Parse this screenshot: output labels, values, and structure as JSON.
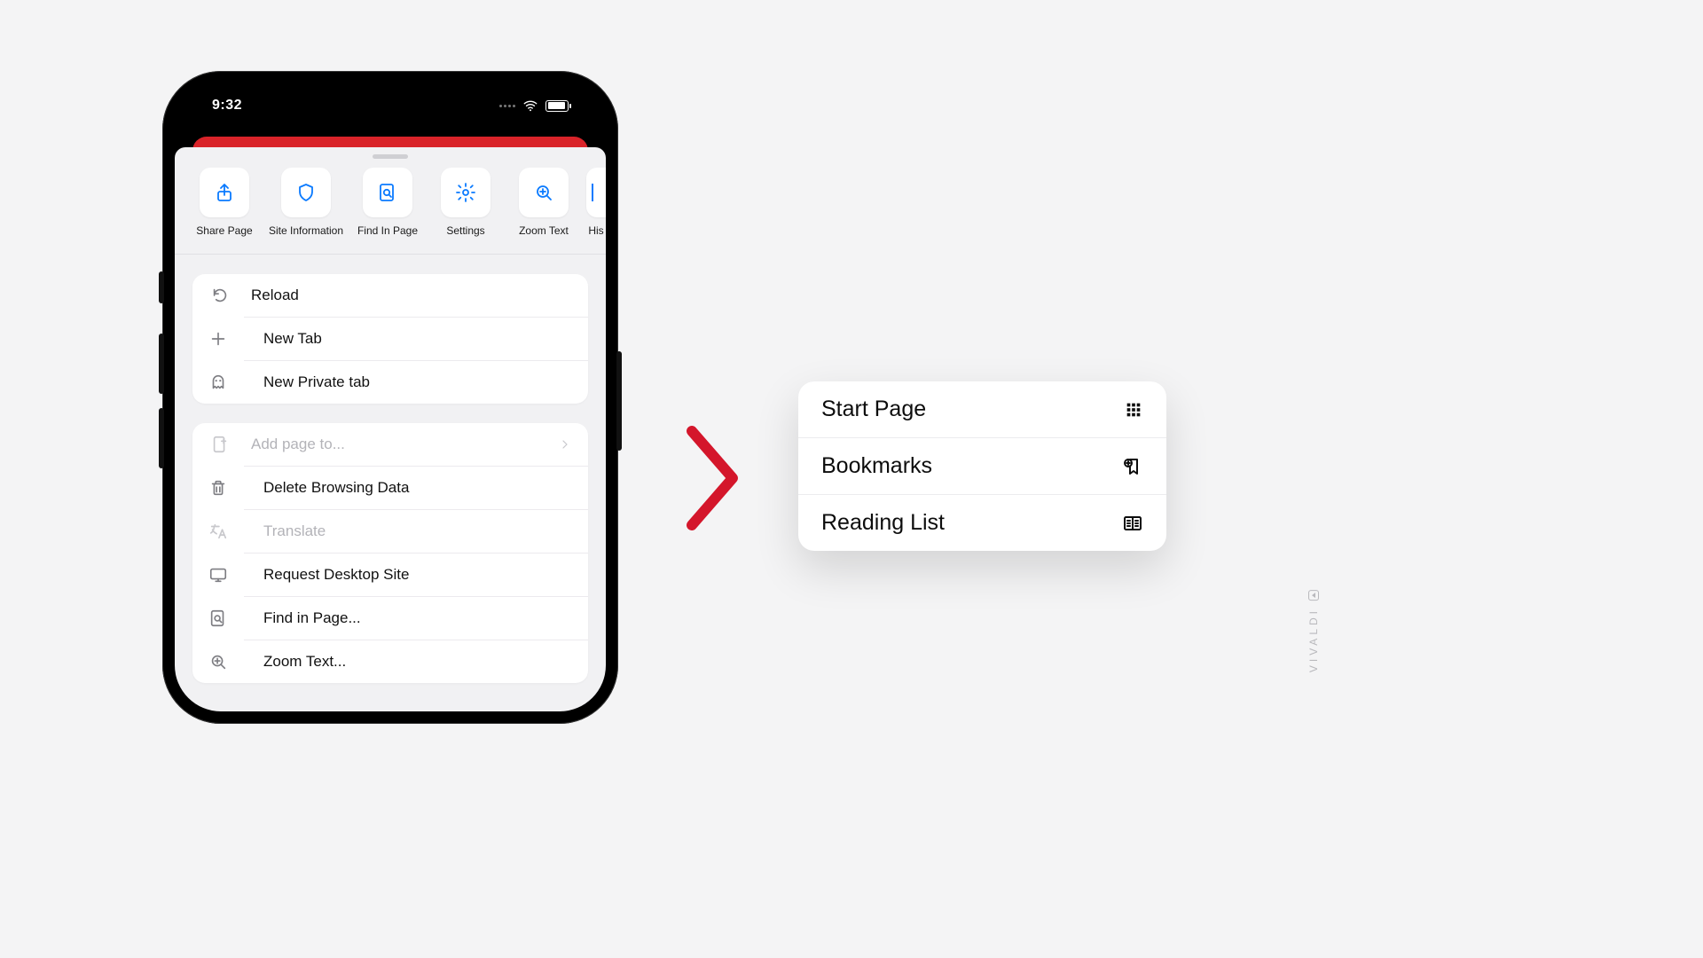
{
  "status": {
    "time": "9:32"
  },
  "quick": [
    {
      "label": "Share Page",
      "icon": "share-icon"
    },
    {
      "label": "Site Information",
      "icon": "shield-icon"
    },
    {
      "label": "Find In Page",
      "icon": "find-icon"
    },
    {
      "label": "Settings",
      "icon": "gear-icon"
    },
    {
      "label": "Zoom Text",
      "icon": "zoom-icon"
    },
    {
      "label": "His",
      "icon": "history-icon",
      "partial": true
    }
  ],
  "group1": [
    {
      "label": "Reload",
      "icon": "reload-icon"
    },
    {
      "label": "New Tab",
      "icon": "plus-icon"
    },
    {
      "label": "New Private tab",
      "icon": "ghost-icon"
    }
  ],
  "group2": [
    {
      "label": "Add page to...",
      "icon": "addpage-icon",
      "disabled": true,
      "chevron": true
    },
    {
      "label": "Delete Browsing Data",
      "icon": "trash-icon"
    },
    {
      "label": "Translate",
      "icon": "translate-icon",
      "disabled": true
    },
    {
      "label": "Request Desktop Site",
      "icon": "desktop-icon"
    },
    {
      "label": "Find in Page...",
      "icon": "find-icon"
    },
    {
      "label": "Zoom Text...",
      "icon": "zoom-icon"
    }
  ],
  "popover": [
    {
      "label": "Start Page",
      "icon": "grid-icon"
    },
    {
      "label": "Bookmarks",
      "icon": "bookmark-add-icon"
    },
    {
      "label": "Reading List",
      "icon": "readlist-icon"
    }
  ],
  "watermark": "VIVALDI"
}
